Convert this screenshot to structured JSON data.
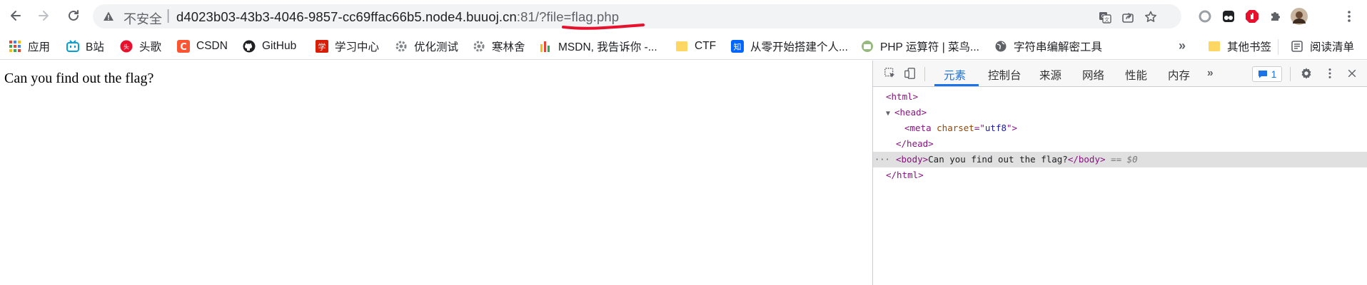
{
  "toolbar": {
    "back_icon": "arrow-left-icon",
    "forward_icon": "arrow-right-icon",
    "reload_icon": "reload-icon",
    "security_label": "不安全",
    "separator": "|",
    "url_host": "d4023b03-43b3-4046-9857-cc69ffac66b5.node4.buuoj.cn",
    "url_rest": ":81/?file=flag.php",
    "underline_color": "#e8112d"
  },
  "bookmarks": {
    "items": [
      {
        "label": "应用",
        "icon": "apps-grid-icon"
      },
      {
        "label": "B站",
        "icon": "bilibili-icon"
      },
      {
        "label": "头歌",
        "icon": "touge-icon"
      },
      {
        "label": "CSDN",
        "icon": "csdn-icon"
      },
      {
        "label": "GitHub",
        "icon": "github-icon"
      },
      {
        "label": "学习中心",
        "icon": "study-center-icon"
      },
      {
        "label": "优化测试",
        "icon": "gear-bookmark-icon"
      },
      {
        "label": "寒林舍",
        "icon": "gear-bookmark-icon"
      },
      {
        "label": "MSDN, 我告诉你 -...",
        "icon": "msdn-icon"
      },
      {
        "label": "CTF",
        "icon": "folder-icon"
      },
      {
        "label": "从零开始搭建个人...",
        "icon": "zhihu-icon"
      },
      {
        "label": "PHP 运算符 | 菜鸟...",
        "icon": "runoob-icon"
      },
      {
        "label": "字符串编解密工具",
        "icon": "globe-icon"
      }
    ],
    "more": "»",
    "other": "其他书签",
    "reading": "阅读清单"
  },
  "page": {
    "text": "Can you find out the flag?"
  },
  "devtools": {
    "tabs": [
      "元素",
      "控制台",
      "来源",
      "网络",
      "性能",
      "内存"
    ],
    "more_tabs": "»",
    "issues_count": "1",
    "dom": {
      "html_open": "<html>",
      "head_open": "<head>",
      "meta_tag_open": "<meta ",
      "meta_attr": "charset",
      "meta_eq": "=\"",
      "meta_val": "utf8",
      "meta_close": "\">",
      "head_close": "</head>",
      "body_open": "<body>",
      "body_text": "Can you find out the flag?",
      "body_close": "</body>",
      "selected_marker": "== $0",
      "html_close": "</html>",
      "dots": "···"
    }
  }
}
